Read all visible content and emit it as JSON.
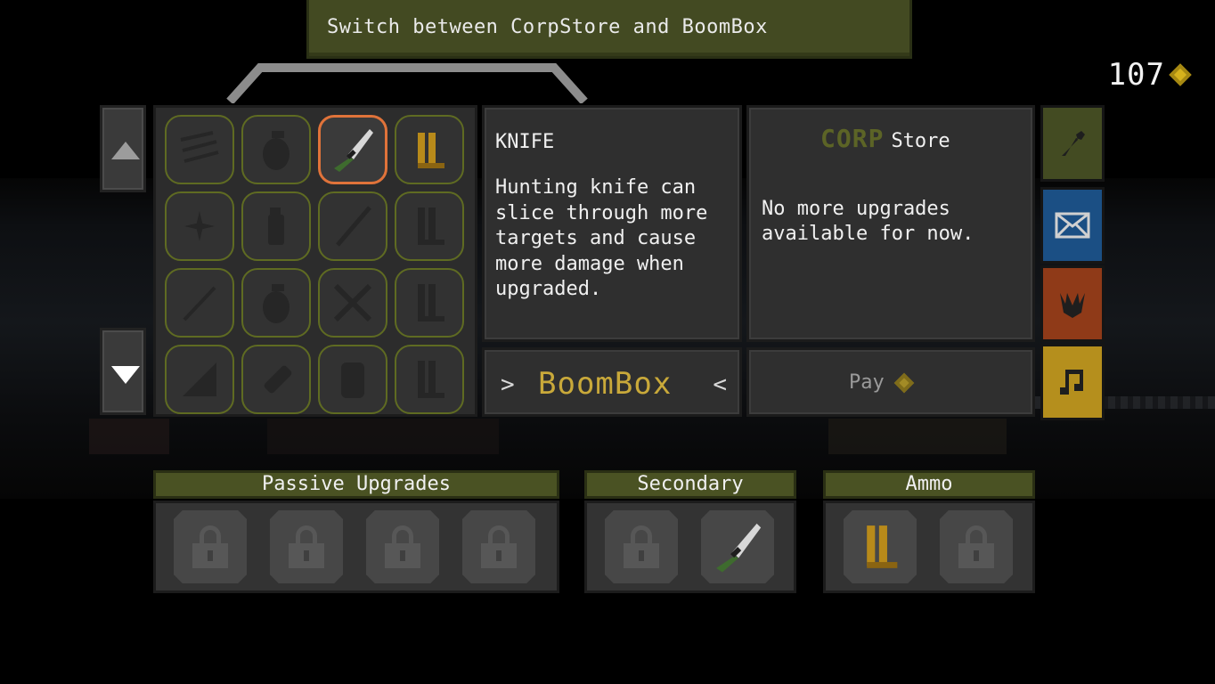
{
  "tooltip": {
    "text": "Switch between CorpStore and BoomBox"
  },
  "currency": {
    "amount": "107",
    "icon": "diamond-icon"
  },
  "item": {
    "title": "KNIFE",
    "description": "Hunting knife can slice through more targets and cause more damage when upgraded."
  },
  "store": {
    "logo": "CORP",
    "title": "Store",
    "message": "No more upgrades available for now."
  },
  "boombox": {
    "left_arrow": ">",
    "label": "BoomBox",
    "right_arrow": "<"
  },
  "pay": {
    "label": "Pay"
  },
  "weapons": [
    "shotgun-icon",
    "grenade-icon",
    "knife-icon",
    "ammo-icon",
    "shuriken-icon",
    "flashbang-icon",
    "bat-icon",
    "ammo-icon",
    "syringe-icon",
    "grenade-icon",
    "crossed-blades-icon",
    "ammo-icon",
    "ramp-icon",
    "flare-icon",
    "vest-icon",
    "ammo-icon"
  ],
  "selected_weapon": "KNIFE",
  "side_tabs": [
    "wrench-icon",
    "mail-icon",
    "creature-icon",
    "music-note-icon"
  ],
  "loadout": {
    "passive": {
      "label": "Passive Upgrades",
      "slots": [
        "locked",
        "locked",
        "locked",
        "locked"
      ]
    },
    "secondary": {
      "label": "Secondary",
      "slots": [
        "locked",
        "knife"
      ]
    },
    "ammo": {
      "label": "Ammo",
      "slots": [
        "ammo",
        "locked"
      ]
    }
  },
  "colors": {
    "accent_olive": "#434a22",
    "selection": "#e0733a",
    "gold": "#d6b21c",
    "mail_tab": "#1b4f84",
    "creature_tab": "#8f3a18",
    "music_tab": "#b58f1d"
  }
}
